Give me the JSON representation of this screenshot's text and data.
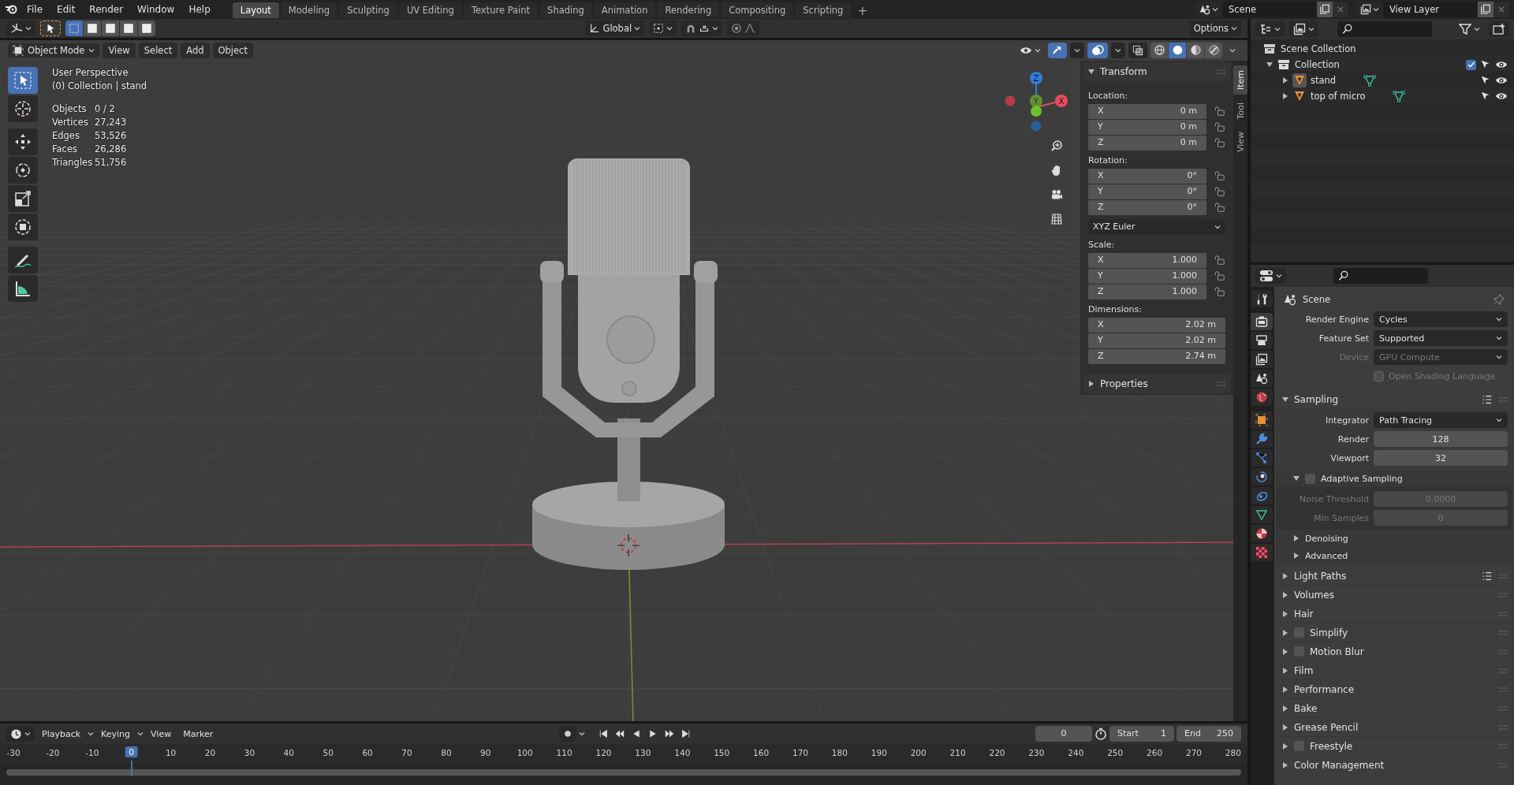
{
  "topbar": {
    "menus": [
      "File",
      "Edit",
      "Render",
      "Window",
      "Help"
    ],
    "workspaces": [
      {
        "label": "Layout",
        "selected": true
      },
      {
        "label": "Modeling",
        "selected": false
      },
      {
        "label": "Sculpting",
        "selected": false
      },
      {
        "label": "UV Editing",
        "selected": false
      },
      {
        "label": "Texture Paint",
        "selected": false
      },
      {
        "label": "Shading",
        "selected": false
      },
      {
        "label": "Animation",
        "selected": false
      },
      {
        "label": "Rendering",
        "selected": false
      },
      {
        "label": "Compositing",
        "selected": false
      },
      {
        "label": "Scripting",
        "selected": false
      }
    ],
    "add_workspace": "+",
    "scene": "Scene",
    "view_layer": "View Layer"
  },
  "viewport": {
    "header": {
      "select_modes": [
        {
          "selected": true
        },
        {
          "selected": false
        },
        {
          "selected": false
        },
        {
          "selected": false
        },
        {
          "selected": false
        }
      ],
      "orientation": "Global",
      "snap_on": false,
      "proportional_on": false,
      "options": "Options",
      "mode": "Object Mode",
      "menus": [
        "View",
        "Select",
        "Add",
        "Object"
      ],
      "gizmos_on": true,
      "overlays_on": true,
      "xray_on": false,
      "shading": [
        {
          "kind": "wireframe",
          "selected": false
        },
        {
          "kind": "solid",
          "selected": true
        },
        {
          "kind": "material",
          "selected": false
        },
        {
          "kind": "rendered",
          "selected": false
        }
      ]
    },
    "tools": [
      {
        "kind": "select",
        "selected": true
      },
      {
        "kind": "cursor",
        "selected": false
      },
      {
        "kind": "move",
        "selected": false
      },
      {
        "kind": "rotate",
        "selected": false
      },
      {
        "kind": "scale",
        "selected": false
      },
      {
        "kind": "transform",
        "selected": false
      },
      {
        "kind": "annotate",
        "selected": false
      },
      {
        "kind": "measure",
        "selected": false
      }
    ],
    "view_name": "User Perspective",
    "context": "(0) Collection | stand",
    "stats": [
      {
        "label": "Objects",
        "value": "0 / 2"
      },
      {
        "label": "Vertices",
        "value": "27,243"
      },
      {
        "label": "Edges",
        "value": "53,526"
      },
      {
        "label": "Faces",
        "value": "26,286"
      },
      {
        "label": "Triangles",
        "value": "51,756"
      }
    ],
    "gizmo": {
      "x": "X",
      "y": "Y",
      "z": "Z"
    },
    "nav_buttons": [
      {
        "kind": "zoom"
      },
      {
        "kind": "pan"
      },
      {
        "kind": "camera"
      },
      {
        "kind": "grid"
      }
    ],
    "sidebar": {
      "tabs": [
        {
          "label": "Item",
          "selected": true
        },
        {
          "label": "Tool",
          "selected": false
        },
        {
          "label": "View",
          "selected": false
        }
      ],
      "panels": [
        {
          "title": "Transform",
          "expanded": true,
          "groups": [
            {
              "label": "Location:",
              "fields": [
                {
                  "axis": "X",
                  "value": "0 m",
                  "locked": false
                },
                {
                  "axis": "Y",
                  "value": "0 m",
                  "locked": false
                },
                {
                  "axis": "Z",
                  "value": "0 m",
                  "locked": false
                }
              ]
            },
            {
              "label": "Rotation:",
              "fields": [
                {
                  "axis": "X",
                  "value": "0°",
                  "locked": false
                },
                {
                  "axis": "Y",
                  "value": "0°",
                  "locked": false
                },
                {
                  "axis": "Z",
                  "value": "0°",
                  "locked": false
                }
              ],
              "mode": "XYZ Euler"
            },
            {
              "label": "Scale:",
              "fields": [
                {
                  "axis": "X",
                  "value": "1.000",
                  "locked": false
                },
                {
                  "axis": "Y",
                  "value": "1.000",
                  "locked": false
                },
                {
                  "axis": "Z",
                  "value": "1.000",
                  "locked": false
                }
              ]
            },
            {
              "label": "Dimensions:",
              "fields": [
                {
                  "axis": "X",
                  "value": "2.02 m"
                },
                {
                  "axis": "Y",
                  "value": "2.02 m"
                },
                {
                  "axis": "Z",
                  "value": "2.74 m"
                }
              ]
            }
          ]
        },
        {
          "title": "Properties",
          "expanded": false
        }
      ]
    }
  },
  "timeline": {
    "menus": [
      "Playback",
      "Keying",
      "View",
      "Marker"
    ],
    "auto_key": false,
    "current_frame": "0",
    "start_label": "Start",
    "start": "1",
    "end_label": "End",
    "end": "250",
    "ruler": [
      "-30",
      "-20",
      "-10",
      "10",
      "20",
      "30",
      "40",
      "50",
      "60",
      "70",
      "80",
      "90",
      "100",
      "110",
      "120",
      "130",
      "140",
      "150",
      "160",
      "170",
      "180",
      "190",
      "200",
      "210",
      "220",
      "230",
      "240",
      "250",
      "260",
      "270",
      "280"
    ],
    "playhead": "0"
  },
  "outliner": {
    "tree": [
      {
        "label": "Scene Collection",
        "kind": "scene",
        "children": [
          {
            "label": "Collection",
            "kind": "collection",
            "expanded": true,
            "checked": true,
            "visible": true,
            "children": [
              {
                "label": "stand",
                "kind": "mesh",
                "expanded": false,
                "active": true,
                "visible": true
              },
              {
                "label": "top of micro",
                "kind": "mesh",
                "expanded": false,
                "active": false,
                "visible": true
              }
            ]
          }
        ]
      }
    ]
  },
  "properties": {
    "tabs": [
      {
        "kind": "tool",
        "selected": false
      },
      {
        "kind": "render",
        "selected": true
      },
      {
        "kind": "output",
        "selected": false
      },
      {
        "kind": "view-layer",
        "selected": false
      },
      {
        "kind": "scene",
        "selected": false
      },
      {
        "kind": "world",
        "selected": false
      },
      {
        "kind": "object",
        "selected": false
      },
      {
        "kind": "modifiers",
        "selected": false
      },
      {
        "kind": "particles",
        "selected": false
      },
      {
        "kind": "physics",
        "selected": false
      },
      {
        "kind": "constraints",
        "selected": false
      },
      {
        "kind": "data",
        "selected": false
      },
      {
        "kind": "material",
        "selected": false
      },
      {
        "kind": "texture",
        "selected": false
      }
    ],
    "context": "Scene",
    "fields": [
      {
        "kind": "dropdown",
        "label": "Render Engine",
        "value": "Cycles",
        "disabled": false
      },
      {
        "kind": "dropdown",
        "label": "Feature Set",
        "value": "Supported",
        "disabled": false
      },
      {
        "kind": "dropdown",
        "label": "Device",
        "value": "GPU Compute",
        "disabled": true
      },
      {
        "kind": "checkbox",
        "label": "Open Shading Language",
        "checked": false,
        "disabled": true
      }
    ],
    "panels": [
      {
        "title": "Sampling",
        "expanded": true,
        "presets": true,
        "rows": [
          {
            "kind": "dropdown",
            "label": "Integrator",
            "value": "Path Tracing",
            "disabled": false
          },
          {
            "kind": "number",
            "label": "Render",
            "value": "128",
            "disabled": false
          },
          {
            "kind": "number",
            "label": "Viewport",
            "value": "32",
            "disabled": false
          }
        ],
        "subpanels": [
          {
            "title": "Adaptive Sampling",
            "expanded": true,
            "checked": false,
            "rows": [
              {
                "kind": "number",
                "label": "Noise Threshold",
                "value": "0.0000",
                "disabled": true
              },
              {
                "kind": "number",
                "label": "Min Samples",
                "value": "0",
                "disabled": true
              }
            ]
          },
          {
            "title": "Denoising",
            "expanded": false
          },
          {
            "title": "Advanced",
            "expanded": false
          }
        ]
      },
      {
        "title": "Light Paths",
        "expanded": false,
        "presets": true
      },
      {
        "title": "Volumes",
        "expanded": false
      },
      {
        "title": "Hair",
        "expanded": false
      },
      {
        "title": "Simplify",
        "expanded": false,
        "checked": false
      },
      {
        "title": "Motion Blur",
        "expanded": false,
        "checked": false
      },
      {
        "title": "Film",
        "expanded": false
      },
      {
        "title": "Performance",
        "expanded": false
      },
      {
        "title": "Bake",
        "expanded": false
      },
      {
        "title": "Grease Pencil",
        "expanded": false
      },
      {
        "title": "Freestyle",
        "expanded": false,
        "checked": false
      },
      {
        "title": "Color Management",
        "expanded": false
      }
    ]
  }
}
